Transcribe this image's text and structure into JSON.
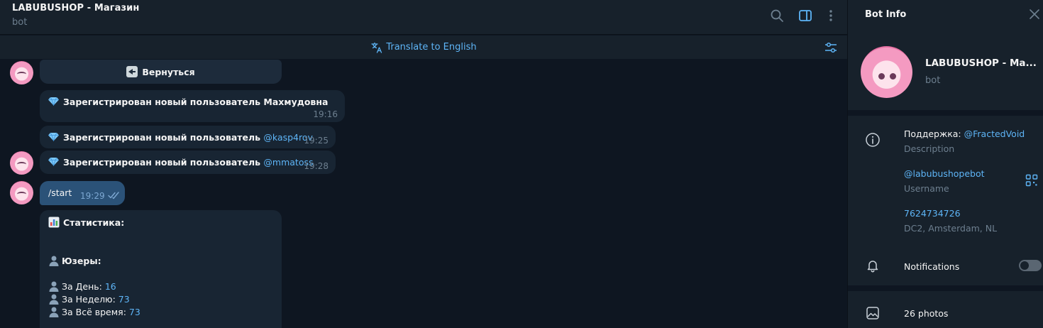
{
  "header": {
    "title": "LABUBUSHOP - Магазин",
    "subtitle": "bot",
    "icons": [
      "search-icon",
      "side-panel-icon",
      "more-vertical-icon"
    ]
  },
  "translate_bar": {
    "label": "Translate to English",
    "icon": "translate-icon",
    "settings_icon": "translate-settings-icon"
  },
  "messages": {
    "back_button": "Вернуться",
    "items": [
      {
        "text": "Зарегистрирован новый пользователь Махмудовна",
        "link": "",
        "time": "19:16"
      },
      {
        "text": "Зарегистрирован новый пользователь ",
        "link": "@kasp4rov",
        "time": "19:25"
      },
      {
        "text": "Зарегистрирован новый пользователь ",
        "link": "@mmatoss",
        "time": "19:28"
      }
    ],
    "outgoing": {
      "text": "/start",
      "time": "19:29"
    },
    "stats": {
      "title": "Статистика:",
      "users_header": "Юзеры:",
      "day_label": "За День: ",
      "day_value": "16",
      "week_label": "За Неделю: ",
      "week_value": "73",
      "all_label": "За Всё время: ",
      "all_value": "73"
    }
  },
  "info_panel": {
    "title": "Bot Info",
    "name": "LABUBUSHOP - Ма...",
    "subtitle": "bot",
    "support_label": "Поддержка: ",
    "support_link": "@FractedVoid",
    "description_label": "Description",
    "username": "@labubushopebot",
    "username_label": "Username",
    "id": "7624734726",
    "dc": "DC2, Amsterdam, NL",
    "notifications_label": "Notifications",
    "notifications_on": false,
    "photos_label": "26 photos"
  },
  "colors": {
    "background": "#0e1621",
    "panel": "#17212b",
    "bubble_in": "#182533",
    "bubble_out": "#2b5278",
    "accent": "#5eb5f7",
    "muted": "#6d7f8f"
  }
}
